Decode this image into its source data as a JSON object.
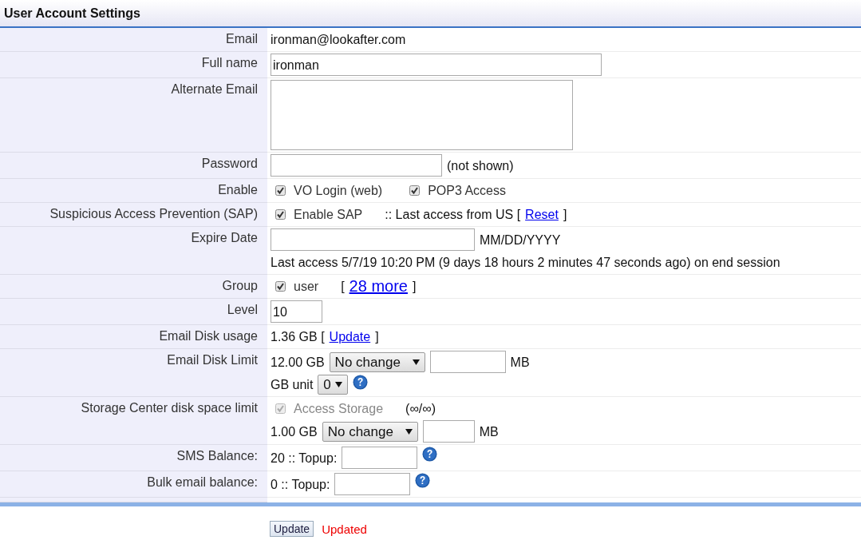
{
  "title": "User Account Settings",
  "rows": [
    {
      "label": "Email",
      "lines": [
        [
          {
            "kind": "text",
            "text": "ironman@lookafter.com"
          }
        ]
      ]
    },
    {
      "label": "Full name",
      "lines": [
        [
          {
            "kind": "input",
            "value": "ironman"
          }
        ]
      ]
    },
    {
      "label": "Alternate Email",
      "lines": [
        [
          {
            "kind": "textarea"
          }
        ]
      ]
    },
    {
      "label": "Password",
      "lines": [
        [
          {
            "kind": "input"
          },
          {
            "kind": "text",
            "text": "(not shown)"
          }
        ]
      ]
    },
    {
      "label": "Enable",
      "lines": [
        [
          {
            "kind": "checkbox",
            "text": "VO Login (web)",
            "checked": true,
            "disabled": false
          },
          {
            "kind": "checkbox",
            "text": "POP3 Access",
            "checked": true,
            "disabled": false
          }
        ]
      ]
    },
    {
      "label": "Suspicious Access Prevention (SAP)",
      "lines": [
        [
          {
            "kind": "checkbox",
            "text": "Enable SAP",
            "checked": true,
            "disabled": false
          },
          {
            "kind": "text",
            "text": ":: Last access from US ["
          },
          {
            "kind": "link",
            "text": "Reset"
          },
          {
            "kind": "text",
            "text": "]"
          }
        ]
      ]
    },
    {
      "label": "Expire Date",
      "lines": [
        [
          {
            "kind": "input"
          },
          {
            "kind": "text",
            "text": "MM/DD/YYYY"
          }
        ],
        [
          {
            "kind": "text",
            "text": "Last access 5/7/19 10:20 PM (9 days 18 hours 2 minutes 47 seconds ago) on end session"
          }
        ]
      ]
    },
    {
      "label": "Group",
      "lines": [
        [
          {
            "kind": "checkbox",
            "text": "user",
            "checked": true,
            "disabled": false
          },
          {
            "kind": "text",
            "text": "["
          },
          {
            "kind": "biglink",
            "text": "28 more"
          },
          {
            "kind": "text",
            "text": "]"
          }
        ]
      ]
    },
    {
      "label": "Level",
      "lines": [
        [
          {
            "kind": "input",
            "value": "10"
          }
        ]
      ]
    },
    {
      "label": "Email Disk usage",
      "lines": [
        [
          {
            "kind": "text",
            "text": "1.36 GB ["
          },
          {
            "kind": "link",
            "text": "Update"
          },
          {
            "kind": "text",
            "text": "]"
          }
        ]
      ]
    },
    {
      "label": "Email Disk Limit",
      "lines": [
        [
          {
            "kind": "text",
            "text": "12.00 GB"
          },
          {
            "kind": "select",
            "value": "No change"
          },
          {
            "kind": "input"
          },
          {
            "kind": "text",
            "text": "MB"
          }
        ],
        [
          {
            "kind": "text",
            "text": "GB unit"
          },
          {
            "kind": "select",
            "value": "0"
          },
          {
            "kind": "help"
          }
        ]
      ]
    },
    {
      "label": "Storage Center disk space limit",
      "lines": [
        [
          {
            "kind": "checkbox",
            "text": "Access Storage",
            "checked": true,
            "disabled": true
          },
          {
            "kind": "text",
            "text": "(∞/∞)"
          }
        ],
        [
          {
            "kind": "text",
            "text": "1.00 GB"
          },
          {
            "kind": "select",
            "value": "No change"
          },
          {
            "kind": "input"
          },
          {
            "kind": "text",
            "text": "MB"
          }
        ]
      ]
    },
    {
      "label": "SMS Balance:",
      "lines": [
        [
          {
            "kind": "text",
            "text": "20 :: Topup:"
          },
          {
            "kind": "input"
          },
          {
            "kind": "help"
          }
        ]
      ]
    },
    {
      "label": "Bulk email balance:",
      "lines": [
        [
          {
            "kind": "text",
            "text": "0 :: Topup:"
          },
          {
            "kind": "input"
          },
          {
            "kind": "help"
          }
        ]
      ]
    }
  ],
  "footer": {
    "button": "Update",
    "status": "Updated"
  }
}
